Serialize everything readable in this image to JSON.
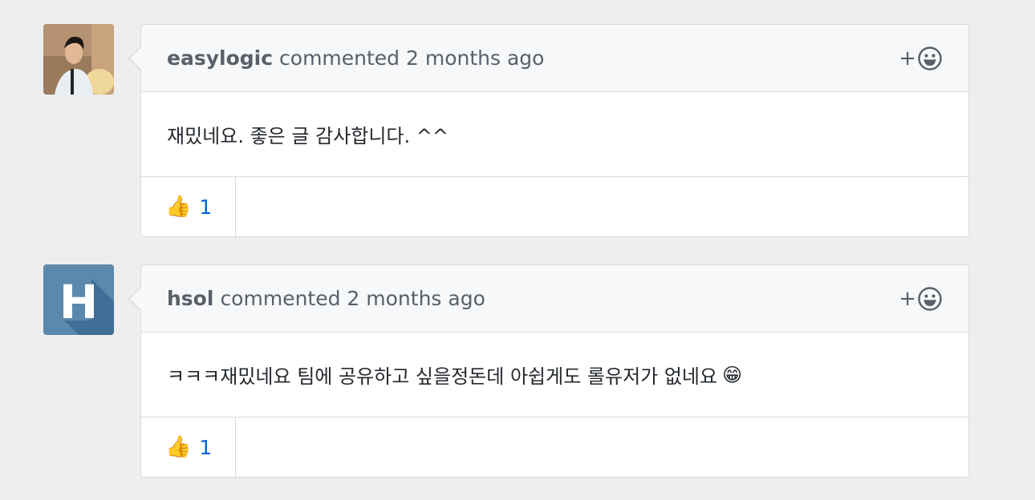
{
  "comments": [
    {
      "author": "easylogic",
      "action": "commented",
      "time": "2 months ago",
      "body": "재밌네요. 좋은 글 감사합니다. ^^",
      "body_emoji": "",
      "reaction_emoji": "👍",
      "reaction_count": "1",
      "add_reaction_plus": "+"
    },
    {
      "author": "hsol",
      "action": "commented",
      "time": "2 months ago",
      "body": "ㅋㅋㅋ재밌네요 팀에 공유하고 싶을정돈데 아쉽게도 롤유저가 없네요",
      "body_emoji": "😁",
      "avatar_letter": "H",
      "reaction_emoji": "👍",
      "reaction_count": "1",
      "add_reaction_plus": "+"
    }
  ],
  "colors": {
    "page_bg": "#eeeeee",
    "header_bg": "#f6f8fa",
    "border": "#d9dcdf",
    "link_blue": "#0366d6",
    "identicon_blue": "#5b88ad"
  },
  "icons": [
    "smiley-icon",
    "thumbs-up-icon"
  ]
}
